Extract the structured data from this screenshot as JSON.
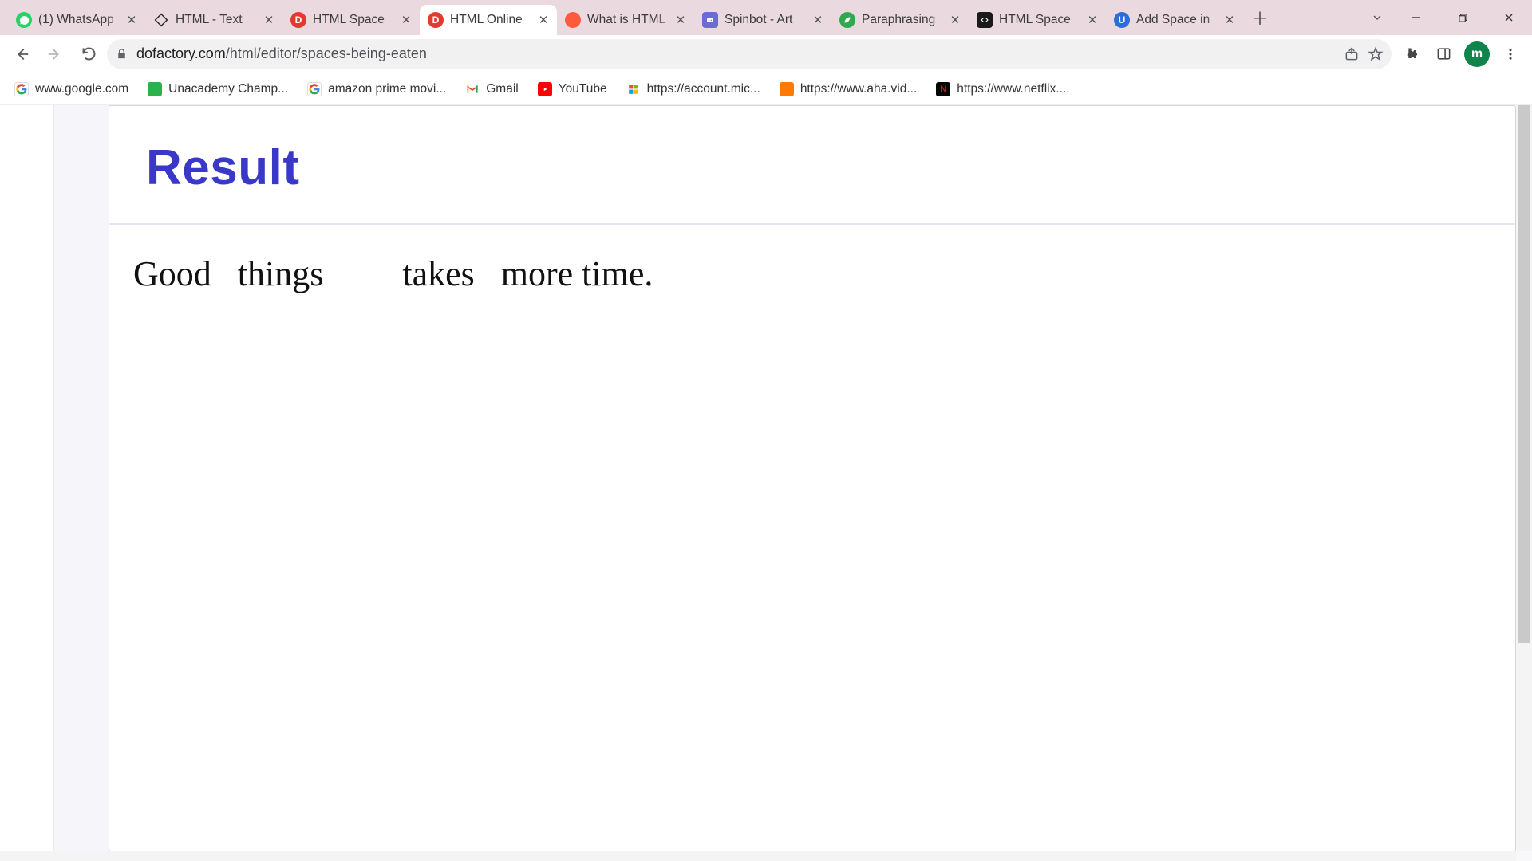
{
  "tabs": [
    {
      "title": "(1) WhatsApp",
      "favicon_bg": "#25d366",
      "favicon_letter": "",
      "active": false
    },
    {
      "title": "HTML - Text",
      "favicon_bg": "#2c2c2c",
      "favicon_letter": "",
      "active": false
    },
    {
      "title": "HTML Space",
      "favicon_bg": "#e23a2e",
      "favicon_letter": "D",
      "active": false
    },
    {
      "title": "HTML Online",
      "favicon_bg": "#e23a2e",
      "favicon_letter": "D",
      "active": true
    },
    {
      "title": "What is HTML",
      "favicon_bg": "#ff5a3c",
      "favicon_letter": "",
      "active": false
    },
    {
      "title": "Spinbot - Art",
      "favicon_bg": "#6b6bd6",
      "favicon_letter": "",
      "active": false
    },
    {
      "title": "Paraphrasing",
      "favicon_bg": "#2fa84f",
      "favicon_letter": "",
      "active": false
    },
    {
      "title": "HTML Space",
      "favicon_bg": "#1a1a1a",
      "favicon_letter": "",
      "active": false
    },
    {
      "title": "Add Space in",
      "favicon_bg": "#2a6fd6",
      "favicon_letter": "",
      "active": false
    }
  ],
  "omnibox": {
    "host": "dofactory.com",
    "path": "/html/editor/spaces-being-eaten"
  },
  "avatar_letter": "m",
  "bookmarks": [
    {
      "label": "www.google.com",
      "icon_bg": "#ffffff",
      "icon_type": "google"
    },
    {
      "label": "Unacademy Champ...",
      "icon_bg": "#2bb24c",
      "icon_type": "solid"
    },
    {
      "label": "amazon prime movi...",
      "icon_bg": "#ffffff",
      "icon_type": "google"
    },
    {
      "label": "Gmail",
      "icon_bg": "#ffffff",
      "icon_type": "gmail"
    },
    {
      "label": "YouTube",
      "icon_bg": "#ff0000",
      "icon_type": "youtube"
    },
    {
      "label": "https://account.mic...",
      "icon_bg": "#ffffff",
      "icon_type": "ms"
    },
    {
      "label": "https://www.aha.vid...",
      "icon_bg": "#ff7a00",
      "icon_type": "solid"
    },
    {
      "label": "https://www.netflix....",
      "icon_bg": "#e50914",
      "icon_type": "netflix"
    }
  ],
  "result": {
    "heading": "Result",
    "text": "Good   things         takes   more time."
  }
}
